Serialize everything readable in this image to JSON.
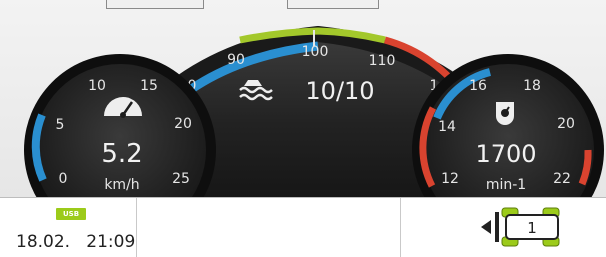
{
  "colors": {
    "accent_blue": "#2a8fd0",
    "accent_green": "#a3c82b",
    "warning_red": "#d9432f",
    "gauge_black": "#111111"
  },
  "center_gauge": {
    "ticks": [
      "90",
      "100",
      "110"
    ],
    "partial_ticks": [
      "0",
      "1"
    ],
    "icon": "engine-load-icon",
    "value": "10/10"
  },
  "speed_gauge": {
    "ticks": [
      "0",
      "5",
      "10",
      "15",
      "20",
      "25"
    ],
    "icon": "speedometer-icon",
    "value": "5.2",
    "unit": "km/h",
    "level": 5.2
  },
  "rpm_gauge": {
    "ticks": [
      "12",
      "14",
      "16",
      "18",
      "20",
      "22"
    ],
    "icon": "engine-speed-icon",
    "value": "1700",
    "unit": "min-1",
    "level": 1700
  },
  "status_bar": {
    "usb_label": "USB",
    "date": "18.02.",
    "time": "21:09",
    "implement_number": "1",
    "arrow_icon": "triangle-left-icon"
  }
}
